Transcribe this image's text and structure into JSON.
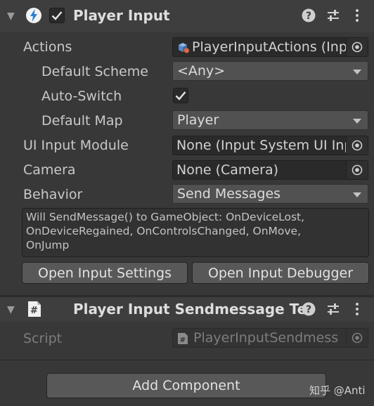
{
  "player_input": {
    "title": "Player Input",
    "enabled": true,
    "fields": {
      "actions": {
        "label": "Actions",
        "value": "PlayerInputActions (Inp"
      },
      "default_scheme": {
        "label": "Default Scheme",
        "value": "<Any>"
      },
      "auto_switch": {
        "label": "Auto-Switch",
        "checked": true
      },
      "default_map": {
        "label": "Default Map",
        "value": "Player"
      },
      "ui_input_module": {
        "label": "UI Input Module",
        "value": "None (Input System UI Inp"
      },
      "camera": {
        "label": "Camera",
        "value": "None (Camera)"
      },
      "behavior": {
        "label": "Behavior",
        "value": "Send Messages"
      }
    },
    "help_lines": [
      "Will SendMessage() to GameObject: OnDeviceLost,",
      "OnDeviceRegained, OnControlsChanged, OnMove,",
      "OnJump"
    ],
    "buttons": {
      "open_settings": "Open Input Settings",
      "open_debugger": "Open Input Debugger"
    }
  },
  "script_component": {
    "title": "Player Input Sendmessage Tes",
    "script_label": "Script",
    "script_value": "PlayerInputSendmess"
  },
  "add_component": "Add Component",
  "watermark": "知乎 @Anti",
  "colors": {
    "background": "#383838",
    "header": "#3e3e3e",
    "field": "#2a2a2a",
    "button": "#585858"
  },
  "icons": {
    "component": "player-input-bolt-icon",
    "script": "csharp-script-icon",
    "asset": "input-actions-asset-icon"
  }
}
